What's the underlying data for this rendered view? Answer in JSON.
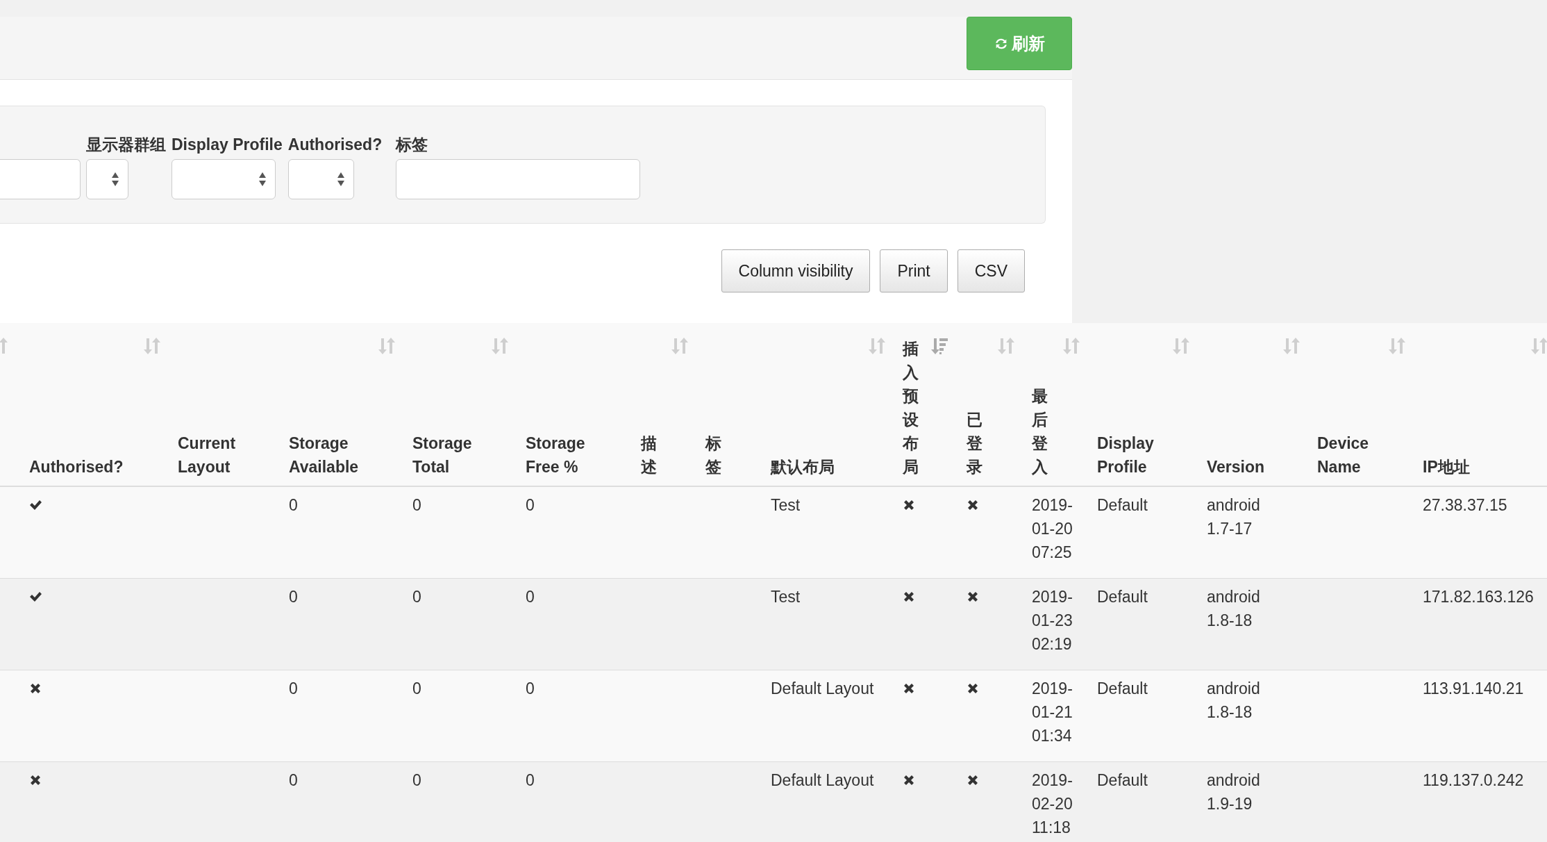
{
  "header": {
    "refresh_button": "刷新"
  },
  "filters": [
    {
      "kind": "input"
    },
    {
      "kind": "select",
      "label": "显示器群组"
    },
    {
      "kind": "select",
      "label": "Display Profile"
    },
    {
      "kind": "select",
      "label": "Authorised?"
    },
    {
      "kind": "input",
      "label": "标签"
    }
  ],
  "table_buttons": [
    "Column visibility",
    "Print",
    "CSV"
  ],
  "table": {
    "columns": [
      {
        "sortable": true,
        "sorted": false
      },
      {
        "label": "Authorised?",
        "sortable": true,
        "sorted": false
      },
      {
        "label": "Current Layout",
        "sortable": false
      },
      {
        "label": "Storage Available",
        "sortable": true,
        "sorted": false
      },
      {
        "label": "Storage Total",
        "sortable": true,
        "sorted": false
      },
      {
        "label": "Storage Free %",
        "sortable": false
      },
      {
        "label": "描述",
        "sortable": true,
        "sorted": false
      },
      {
        "label": "标签",
        "sortable": false
      },
      {
        "label": "默认布局",
        "sortable": true,
        "sorted": false
      },
      {
        "label": "插入预设布局",
        "sortable": true,
        "sorted": true
      },
      {
        "label": "已登录",
        "sortable": true,
        "sorted": false
      },
      {
        "label": "最后登入",
        "sortable": true,
        "sorted": false
      },
      {
        "label": "Display Profile",
        "sortable": true,
        "sorted": false
      },
      {
        "label": "Version",
        "sortable": true,
        "sorted": false
      },
      {
        "label": "Device Name",
        "sortable": true,
        "sorted": false
      },
      {
        "label": "IP地址",
        "sortable": true,
        "sorted": false
      }
    ],
    "rows": [
      {
        "authorised": true,
        "storage_available": "0",
        "storage_total": "0",
        "storage_free": "0",
        "default_layout": "Test",
        "preset_inserted": false,
        "logged_in": false,
        "last_login": "2019-01-20 07:25",
        "display_profile": "Default",
        "version": "android 1.7-17",
        "ip": "27.38.37.15"
      },
      {
        "authorised": true,
        "storage_available": "0",
        "storage_total": "0",
        "storage_free": "0",
        "default_layout": "Test",
        "preset_inserted": false,
        "logged_in": false,
        "last_login": "2019-01-23 02:19",
        "display_profile": "Default",
        "version": "android 1.8-18",
        "ip": "171.82.163.126"
      },
      {
        "authorised": false,
        "storage_available": "0",
        "storage_total": "0",
        "storage_free": "0",
        "default_layout": "Default Layout",
        "preset_inserted": false,
        "logged_in": false,
        "last_login": "2019-01-21 01:34",
        "display_profile": "Default",
        "version": "android 1.8-18",
        "ip": "113.91.140.21"
      },
      {
        "authorised": false,
        "storage_available": "0",
        "storage_total": "0",
        "storage_free": "0",
        "default_layout": "Default Layout",
        "preset_inserted": false,
        "logged_in": false,
        "last_login": "2019-02-20 11:18",
        "display_profile": "Default",
        "version": "android 1.9-19",
        "ip": "119.137.0.242"
      }
    ]
  }
}
